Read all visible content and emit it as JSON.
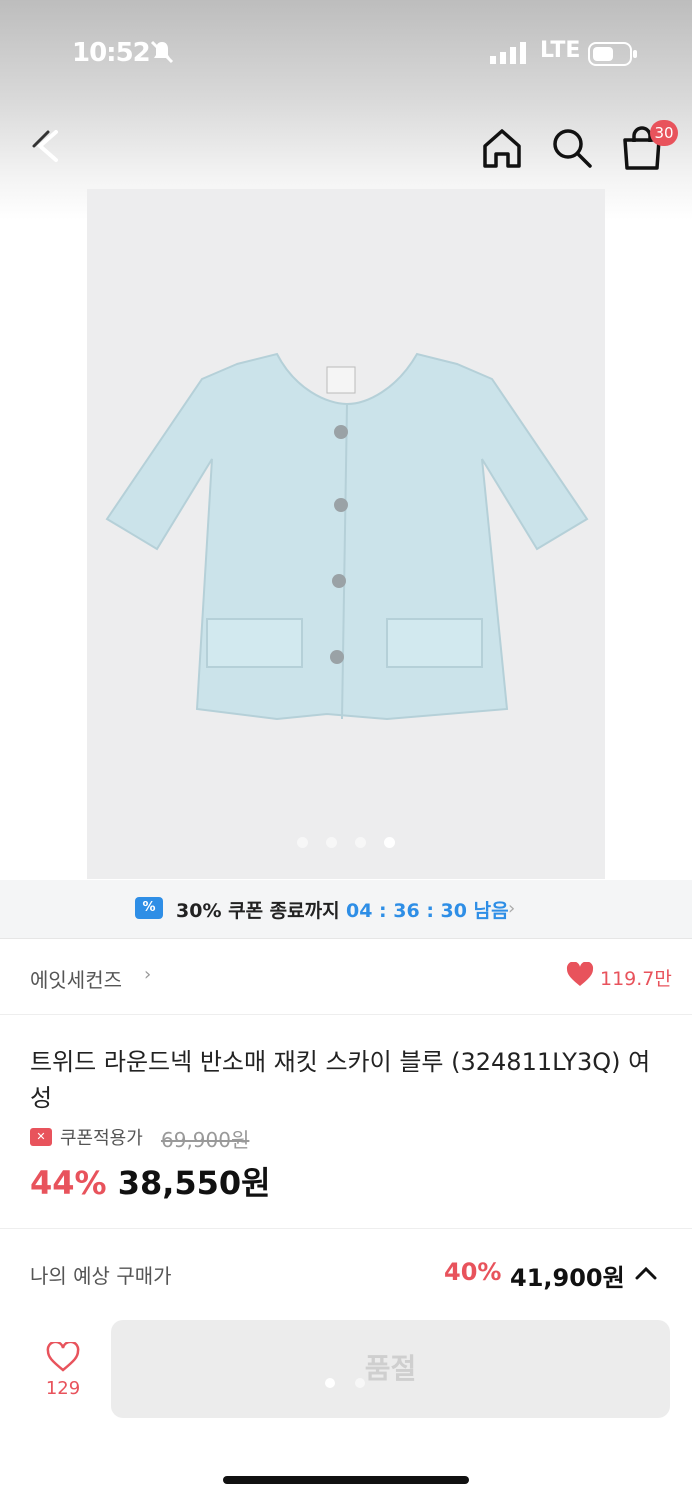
{
  "status_bar": {
    "time": "10:52",
    "network": "LTE"
  },
  "nav": {
    "cart_count": "30"
  },
  "product_image": {
    "slide_count": 4,
    "active_slide": 4
  },
  "coupon_banner": {
    "text": "30% 쿠폰 종료까지",
    "countdown": "04 : 36 : 30 남음"
  },
  "brand": {
    "name": "에잇세컨즈",
    "likes": "119.7만"
  },
  "product": {
    "title": "트위드 라운드넥 반소매 재킷 스카이 블루 (324811LY3Q) 여성",
    "price_label": "쿠폰적용가",
    "original_price": "69,900원",
    "discount_rate": "44%",
    "final_price": "38,550원"
  },
  "expected_price": {
    "label": "나의 예상 구매가",
    "rate": "40%",
    "price": "41,900원"
  },
  "bottom": {
    "wish_count": "129",
    "buy_label": "품절"
  },
  "colors": {
    "accent_red": "#e8535c",
    "accent_blue": "#2e8ee6",
    "jacket": "#c9e2ea"
  }
}
